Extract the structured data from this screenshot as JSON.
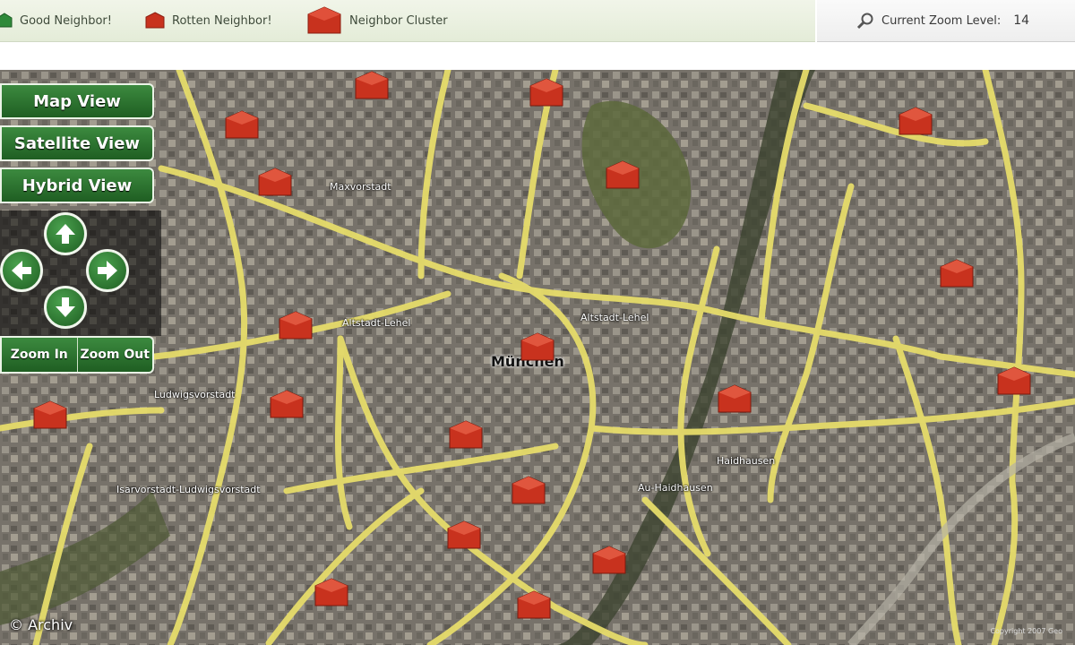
{
  "legend": {
    "items": [
      {
        "label": "Good Neighbor!",
        "icon": "green-house-icon",
        "color": "#2f8a3a"
      },
      {
        "label": "Rotten Neighbor!",
        "icon": "red-house-icon",
        "color": "#c8321e"
      },
      {
        "label": "Neighbor Cluster",
        "icon": "red-cluster-icon",
        "color": "#c8321e"
      }
    ]
  },
  "zoom": {
    "icon": "magnifier-icon",
    "label": "Current Zoom Level:",
    "value": "14"
  },
  "controls": {
    "map_view": "Map View",
    "satellite_view": "Satellite View",
    "hybrid_view": "Hybrid View",
    "zoom_in": "Zoom In",
    "zoom_out": "Zoom Out",
    "arrows": [
      "arrow-up-icon",
      "arrow-left-icon",
      "arrow-right-icon",
      "arrow-down-icon"
    ]
  },
  "map": {
    "labels": {
      "maxvorstadt": "Maxvorstadt",
      "altstadt": "Altstadt-Lehel",
      "altstadt2": "Altstadt-Lehel",
      "muenchen": "München",
      "ludwigsvorstadt": "Ludwigsvorstadt",
      "isarvorstadt": "Isarvorstadt-Ludwigsvorstadt",
      "haidhausen": "Haidhausen",
      "auhaidhausen": "Au-Haidhausen"
    },
    "marker_color": "#c8321e"
  },
  "credit": "© Archiv",
  "small_copyright": "Copyright 2007 Geo"
}
